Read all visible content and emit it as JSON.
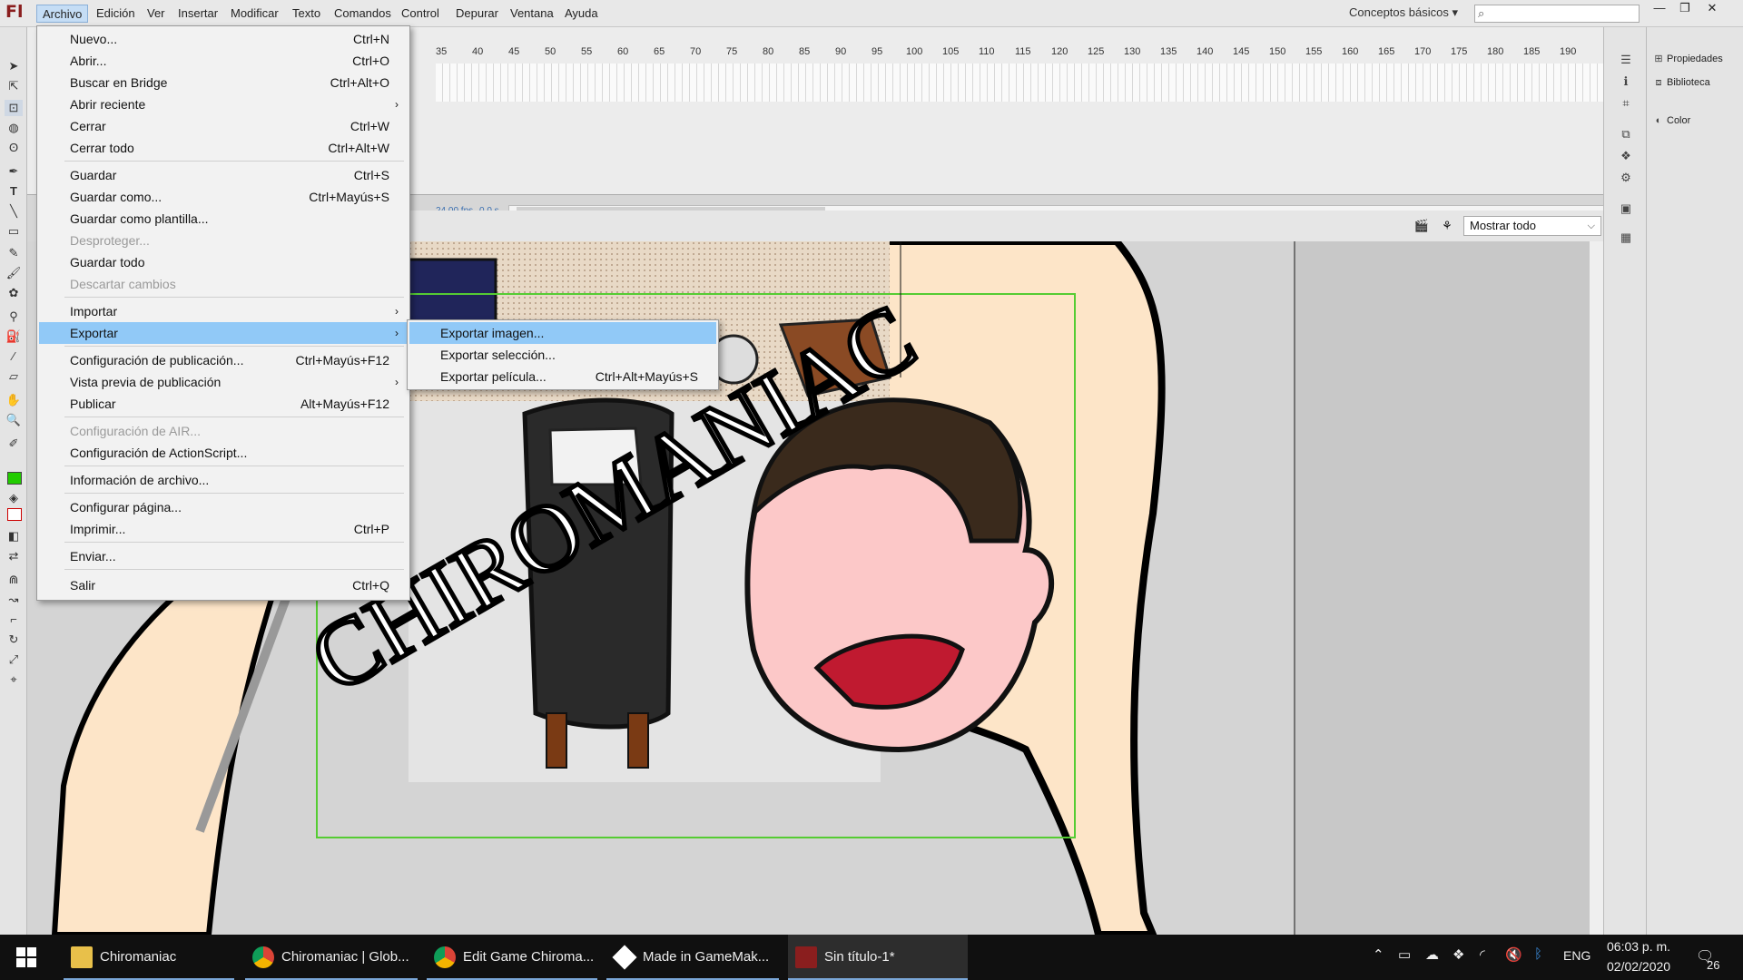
{
  "menubar": {
    "logo": "Fl",
    "items": [
      "Archivo",
      "Edición",
      "Ver",
      "Insertar",
      "Modificar",
      "Texto",
      "Comandos",
      "Control",
      "Depurar",
      "Ventana",
      "Ayuda"
    ],
    "workspace": "Conceptos básicos ▾",
    "search_placeholder": ""
  },
  "timeline": {
    "ruler_ticks": [
      "35",
      "40",
      "45",
      "50",
      "55",
      "60",
      "65",
      "70",
      "75",
      "80",
      "85",
      "90",
      "95",
      "100",
      "105",
      "110",
      "115",
      "120",
      "125",
      "130",
      "135",
      "140",
      "145",
      "150",
      "155",
      "160",
      "165",
      "170",
      "175",
      "180",
      "185",
      "190"
    ],
    "fps": "24.00 fps",
    "time": "0.0 s"
  },
  "stage": {
    "zoom": "Mostrar todo",
    "title_art": "CHIROMANIAC"
  },
  "panels": {
    "items": [
      "Propiedades",
      "Biblioteca",
      "Color"
    ]
  },
  "file_menu": {
    "items": [
      {
        "label": "Nuevo...",
        "shortcut": "Ctrl+N"
      },
      {
        "label": "Abrir...",
        "shortcut": "Ctrl+O"
      },
      {
        "label": "Buscar en Bridge",
        "shortcut": "Ctrl+Alt+O"
      },
      {
        "label": "Abrir reciente",
        "shortcut": ""
      },
      {
        "label": "Cerrar",
        "shortcut": "Ctrl+W"
      },
      {
        "label": "Cerrar todo",
        "shortcut": "Ctrl+Alt+W"
      },
      {
        "label": "Guardar",
        "shortcut": "Ctrl+S"
      },
      {
        "label": "Guardar como...",
        "shortcut": "Ctrl+Mayús+S"
      },
      {
        "label": "Guardar como plantilla...",
        "shortcut": ""
      },
      {
        "label": "Desproteger...",
        "shortcut": ""
      },
      {
        "label": "Guardar todo",
        "shortcut": ""
      },
      {
        "label": "Descartar cambios",
        "shortcut": ""
      },
      {
        "label": "Importar",
        "shortcut": ""
      },
      {
        "label": "Exportar",
        "shortcut": ""
      },
      {
        "label": "Configuración de publicación...",
        "shortcut": "Ctrl+Mayús+F12"
      },
      {
        "label": "Vista previa de publicación",
        "shortcut": ""
      },
      {
        "label": "Publicar",
        "shortcut": "Alt+Mayús+F12"
      },
      {
        "label": "Configuración de AIR...",
        "shortcut": ""
      },
      {
        "label": "Configuración de ActionScript...",
        "shortcut": ""
      },
      {
        "label": "Información de archivo...",
        "shortcut": ""
      },
      {
        "label": "Configurar página...",
        "shortcut": ""
      },
      {
        "label": "Imprimir...",
        "shortcut": "Ctrl+P"
      },
      {
        "label": "Enviar...",
        "shortcut": ""
      },
      {
        "label": "Salir",
        "shortcut": "Ctrl+Q"
      }
    ]
  },
  "export_menu": {
    "items": [
      {
        "label": "Exportar imagen...",
        "shortcut": ""
      },
      {
        "label": "Exportar selección...",
        "shortcut": ""
      },
      {
        "label": "Exportar película...",
        "shortcut": "Ctrl+Alt+Mayús+S"
      }
    ]
  },
  "taskbar": {
    "items": [
      "Chiromaniac",
      "Chiromaniac | Glob...",
      "Edit Game Chiroma...",
      "Made in GameMak...",
      "Sin título-1*"
    ],
    "language": "ENG",
    "time": "06:03 p. m.",
    "date": "02/02/2020",
    "notifications": "26"
  },
  "colors": {
    "menu_highlight": "#91c9f7",
    "stage_border": "#55cc33",
    "skin": "#fde5c8",
    "flash_red": "#8a1e1e"
  }
}
